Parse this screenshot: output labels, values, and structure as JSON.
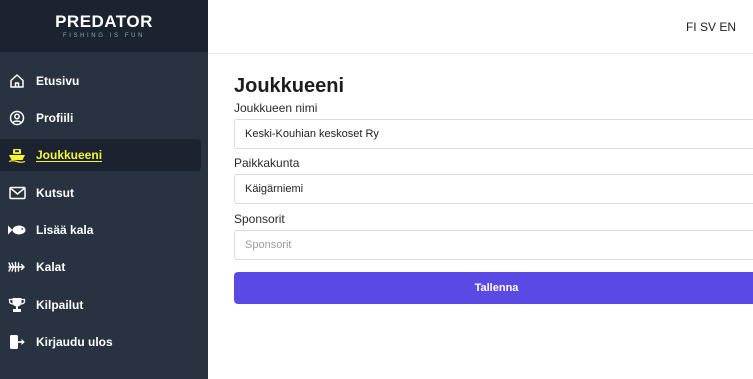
{
  "brand": {
    "title": "PREDATOR",
    "tagline": "FISHING IS FUN"
  },
  "languages": [
    "FI",
    "SV",
    "EN"
  ],
  "sidebar": {
    "items": [
      {
        "label": "Etusivu",
        "icon": "home-icon",
        "active": false
      },
      {
        "label": "Profiili",
        "icon": "user-circle-icon",
        "active": false
      },
      {
        "label": "Joukkueeni",
        "icon": "boat-icon",
        "active": true
      },
      {
        "label": "Kutsut",
        "icon": "envelope-icon",
        "active": false
      },
      {
        "label": "Lisää kala",
        "icon": "fish-icon",
        "active": false
      },
      {
        "label": "Kalat",
        "icon": "fish-skeleton-icon",
        "active": false
      },
      {
        "label": "Kilpailut",
        "icon": "trophy-icon",
        "active": false
      },
      {
        "label": "Kirjaudu ulos",
        "icon": "logout-icon",
        "active": false
      }
    ],
    "active_color": "#f5f534"
  },
  "main": {
    "title": "Joukkueeni",
    "fields": [
      {
        "label": "Joukkueen nimi",
        "value": "Keski-Kouhian keskoset Ry",
        "placeholder": ""
      },
      {
        "label": "Paikkakunta",
        "value": "Käigärniemi",
        "placeholder": ""
      },
      {
        "label": "Sponsorit",
        "value": "",
        "placeholder": "Sponsorit"
      }
    ],
    "save_label": "Tallenna",
    "button_color": "#5b49e6"
  }
}
